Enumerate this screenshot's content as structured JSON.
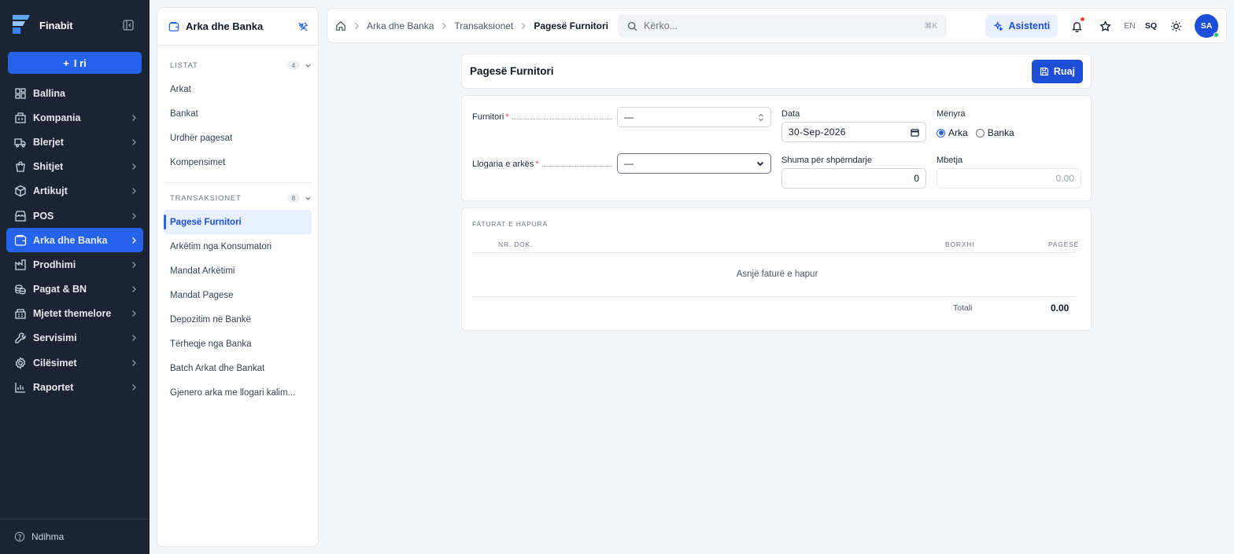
{
  "app": {
    "name": "Finabit",
    "new_label": "I ri"
  },
  "sidebar": {
    "items": [
      {
        "label": "Ballina",
        "icon": "dashboard-icon",
        "chevron": false,
        "active": false
      },
      {
        "label": "Kompania",
        "icon": "building-icon",
        "chevron": true,
        "active": false
      },
      {
        "label": "Blerjet",
        "icon": "truck-icon",
        "chevron": true,
        "active": false
      },
      {
        "label": "Shitjet",
        "icon": "shopping-bag-icon",
        "chevron": true,
        "active": false
      },
      {
        "label": "Artikujt",
        "icon": "box-icon",
        "chevron": true,
        "active": false
      },
      {
        "label": "POS",
        "icon": "store-icon",
        "chevron": true,
        "active": false
      },
      {
        "label": "Arka dhe Banka",
        "icon": "wallet-icon",
        "chevron": true,
        "active": true
      },
      {
        "label": "Prodhimi",
        "icon": "factory-icon",
        "chevron": true,
        "active": false
      },
      {
        "label": "Pagat & BN",
        "icon": "coins-icon",
        "chevron": true,
        "active": false
      },
      {
        "label": "Mjetet themelore",
        "icon": "assets-icon",
        "chevron": true,
        "active": false
      },
      {
        "label": "Servisimi",
        "icon": "wrench-icon",
        "chevron": true,
        "active": false
      },
      {
        "label": "Cilësimet",
        "icon": "gear-icon",
        "chevron": true,
        "active": false
      },
      {
        "label": "Raportet",
        "icon": "bar-chart-icon",
        "chevron": true,
        "active": false
      }
    ],
    "help_label": "Ndihma"
  },
  "subpanel": {
    "title": "Arka dhe Banka",
    "sections": [
      {
        "title": "LISTAT",
        "count": "4",
        "items": [
          "Arkat",
          "Bankat",
          "Urdhër pagesat",
          "Kompensimet"
        ]
      },
      {
        "title": "TRANSAKSIONET",
        "count": "8",
        "items": [
          "Pagesë Furnitori",
          "Arkëtim nga Konsumatori",
          "Mandat Arkëtimi",
          "Mandat Pagese",
          "Depozitim në Bankë",
          "Tërheqje nga Banka",
          "Batch Arkat dhe Bankat",
          "Gjenero arka me llogari kalim..."
        ]
      }
    ],
    "active_item": "Pagesë Furnitori"
  },
  "topbar": {
    "breadcrumb": [
      "Arka dhe Banka",
      "Transaksionet",
      "Pagesë Furnitori"
    ],
    "search_placeholder": "Kërko...",
    "search_shortcut": "⌘K",
    "assistant_label": "Asistenti",
    "lang_en": "EN",
    "lang_sq": "SQ",
    "avatar_initials": "SA"
  },
  "page": {
    "title": "Pagesë Furnitori",
    "save_label": "Ruaj"
  },
  "form": {
    "supplier_label": "Furnitori",
    "supplier_value": "—",
    "account_label": "Llogaria e arkës",
    "account_value": "—",
    "date_label": "Data",
    "date_value": "30-Sep-2026",
    "method_label": "Mënyra",
    "method_options": [
      "Arka",
      "Banka"
    ],
    "method_selected": "Arka",
    "amount_label": "Shuma për shpërndarje",
    "amount_value": "0",
    "balance_label": "Mbetja",
    "balance_value": "0.00",
    "required_mark": "*"
  },
  "invoices": {
    "title": "FATURAT E HAPURA",
    "columns": [
      "NR. DOK.",
      "BORXHI",
      "PAGESË"
    ],
    "empty_text": "Asnjë faturë e hapur",
    "total_label": "Totali",
    "total_value": "0.00"
  },
  "colors": {
    "sidebar_bg": "#1c2434",
    "accent": "#2563eb",
    "page_bg": "#f4f5f7"
  }
}
